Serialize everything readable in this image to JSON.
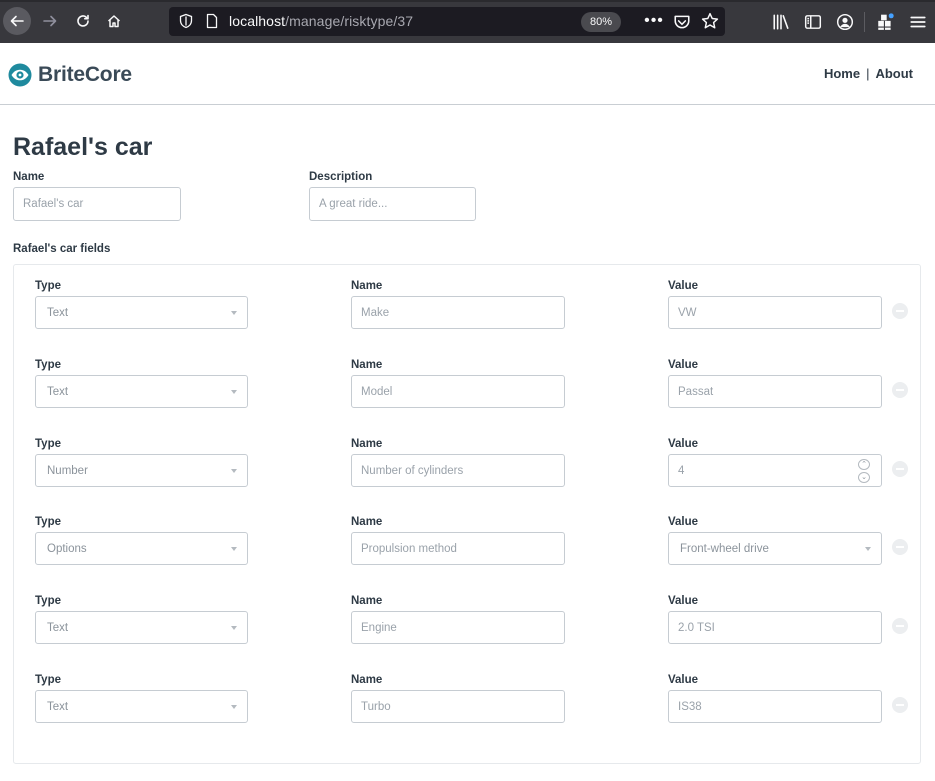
{
  "browser": {
    "url_host": "localhost",
    "url_path": "/manage/risktype/37",
    "zoom": "80%"
  },
  "header": {
    "brand": "BriteCore",
    "nav": [
      "Home",
      "About"
    ]
  },
  "page": {
    "title": "Rafael's car",
    "name_label": "Name",
    "name_value": "Rafael's car",
    "description_label": "Description",
    "description_placeholder": "A great ride...",
    "fields_caption": "Rafael's car fields"
  },
  "fields": [
    {
      "type_label": "Type",
      "type": "Text",
      "name_label": "Name",
      "name": "Make",
      "value_label": "Value",
      "value": "VW",
      "value_kind": "text"
    },
    {
      "type_label": "Type",
      "type": "Text",
      "name_label": "Name",
      "name": "Model",
      "value_label": "Value",
      "value": "Passat",
      "value_kind": "text"
    },
    {
      "type_label": "Type",
      "type": "Number",
      "name_label": "Name",
      "name": "Number of cylinders",
      "value_label": "Value",
      "value": "4",
      "value_kind": "number"
    },
    {
      "type_label": "Type",
      "type": "Options",
      "name_label": "Name",
      "name": "Propulsion method",
      "value_label": "Value",
      "value": "Front-wheel drive",
      "value_kind": "select"
    },
    {
      "type_label": "Type",
      "type": "Text",
      "name_label": "Name",
      "name": "Engine",
      "value_label": "Value",
      "value": "2.0 TSI",
      "value_kind": "text"
    },
    {
      "type_label": "Type",
      "type": "Text",
      "name_label": "Name",
      "name": "Turbo",
      "value_label": "Value",
      "value": "IS38",
      "value_kind": "text"
    }
  ],
  "colors": {
    "brand_accent": "#1f8a9e",
    "text_dark": "#2e3a45",
    "input_border": "#c6ccd2"
  }
}
